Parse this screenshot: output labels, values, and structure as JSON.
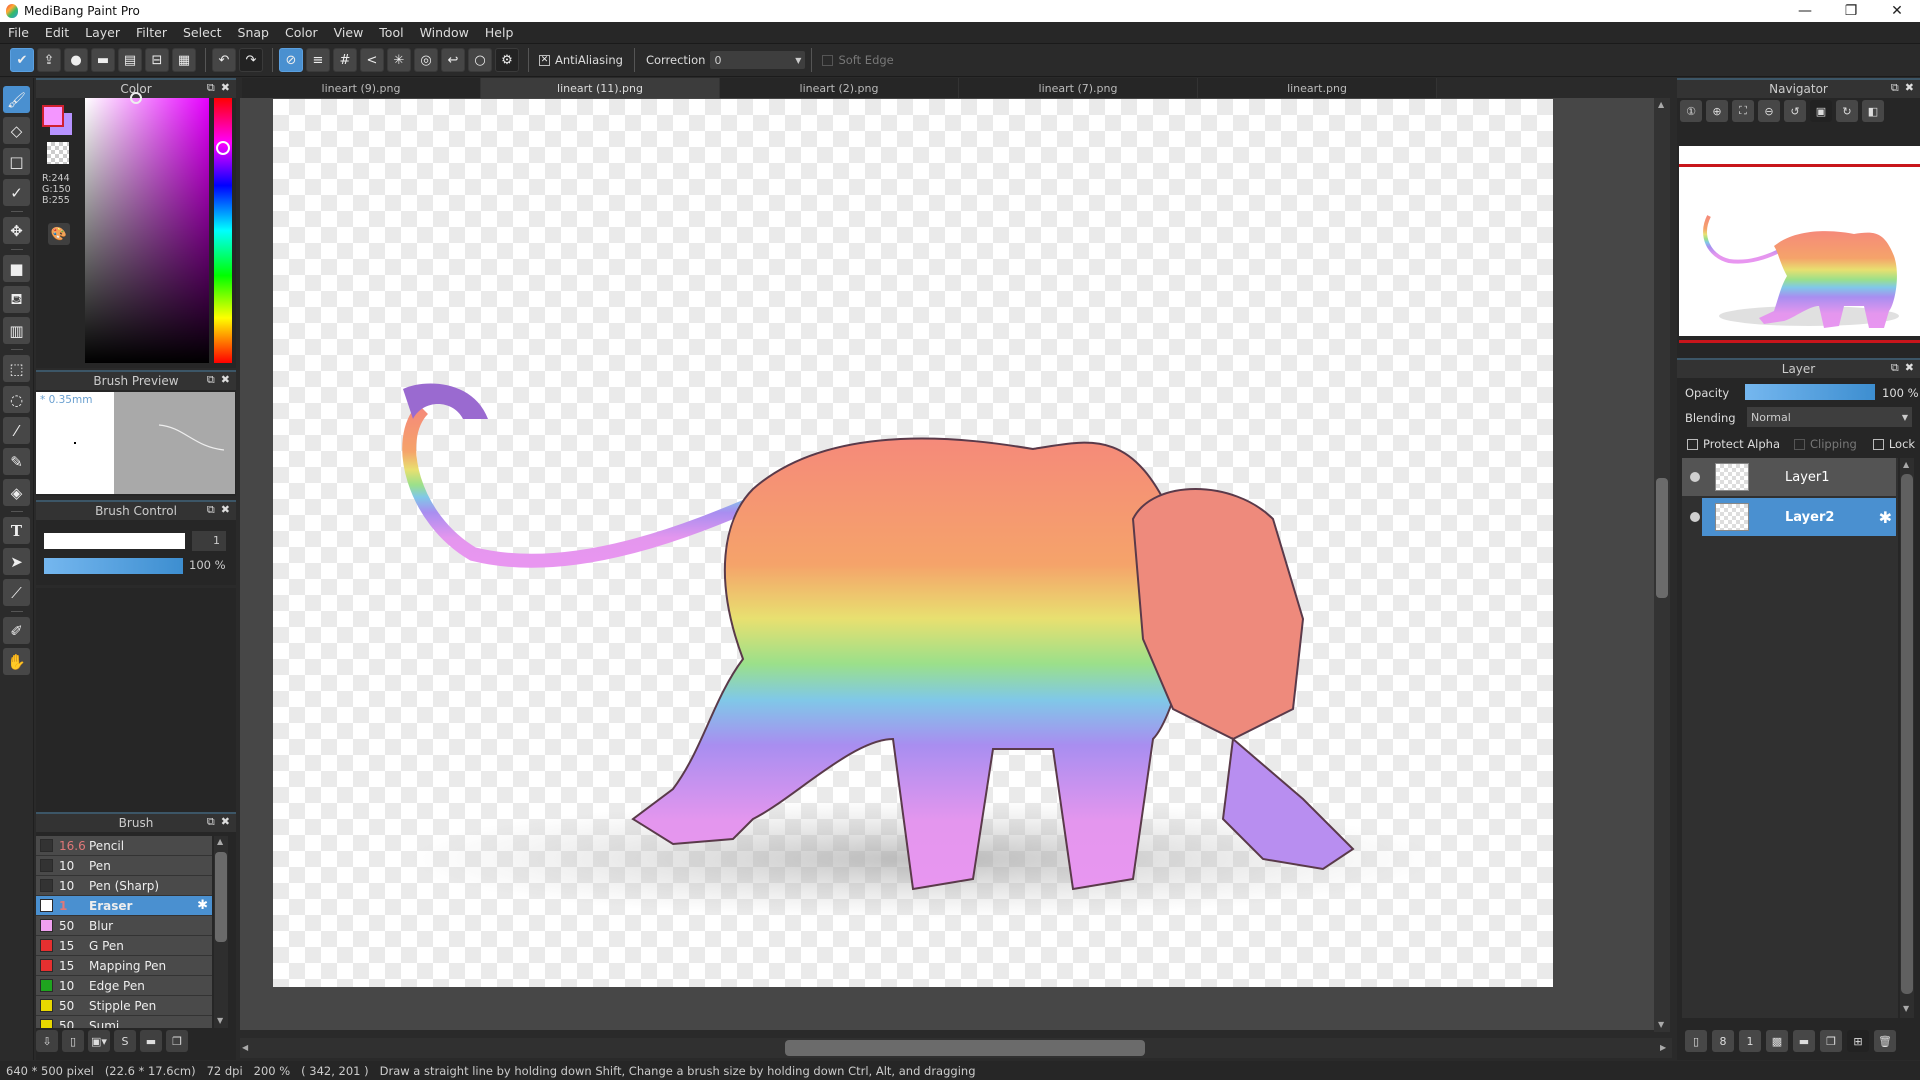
{
  "app": {
    "title": "MediBang Paint Pro",
    "window_controls": {
      "minimize": "—",
      "restore": "❐",
      "close": "✕"
    }
  },
  "menu": [
    "File",
    "Edit",
    "Layer",
    "Filter",
    "Select",
    "Snap",
    "Color",
    "View",
    "Tool",
    "Window",
    "Help"
  ],
  "toolbar": {
    "left_icons": [
      "cloud-save-icon",
      "export-icon",
      "comment-icon",
      "speech-icon",
      "document-icon",
      "schedule-icon",
      "panel-layout-icon"
    ],
    "undo_label": "↶",
    "redo_label": "↷",
    "snap_icons": [
      "snap-off-icon",
      "parallel-snap-icon",
      "grid-snap-icon",
      "perspective-snap-icon",
      "radial-snap-icon",
      "concentric-snap-icon",
      "curve-snap-icon",
      "ellipse-snap-icon",
      "snap-settings-icon"
    ],
    "antialiasing_label": "AntiAliasing",
    "antialiasing_checked": true,
    "correction_label": "Correction",
    "correction_value": "0",
    "soft_edge_label": "Soft Edge",
    "soft_edge_checked": false
  },
  "tools": [
    "brush",
    "eraser",
    "dot",
    "stroke",
    "move",
    "fill-rect",
    "bucket",
    "gradient",
    "select-rect",
    "lasso",
    "magic-wand",
    "select-pen",
    "select-eraser",
    "text",
    "operation",
    "divide",
    "eyedropper",
    "hand"
  ],
  "color_panel": {
    "title": "Color",
    "foreground": "#f496ff",
    "background": "#b793ff",
    "r": "R:244",
    "g": "G:150",
    "b": "B:255"
  },
  "brush_preview": {
    "title": "Brush Preview",
    "size": "* 0.35mm"
  },
  "brush_control": {
    "title": "Brush Control",
    "size_value": "1",
    "opacity_value": "100 %",
    "opacity_fraction": 1.0
  },
  "brush_panel": {
    "title": "Brush",
    "items": [
      {
        "size": "16.6",
        "name": "Pencil",
        "color": "#333333",
        "size_color": "#e07878"
      },
      {
        "size": "10",
        "name": "Pen",
        "color": "#333333"
      },
      {
        "size": "10",
        "name": "Pen (Sharp)",
        "color": "#333333"
      },
      {
        "size": "1",
        "name": "Eraser",
        "color": "#ffffff",
        "selected": true,
        "size_color": "#e07878"
      },
      {
        "size": "50",
        "name": "Blur",
        "color": "#f0a0f0"
      },
      {
        "size": "15",
        "name": "G Pen",
        "color": "#e53030"
      },
      {
        "size": "15",
        "name": "Mapping Pen",
        "color": "#e53030"
      },
      {
        "size": "10",
        "name": "Edge Pen",
        "color": "#1fa51f"
      },
      {
        "size": "50",
        "name": "Stipple Pen",
        "color": "#e8d800"
      },
      {
        "size": "50",
        "name": "Sumi",
        "color": "#e8d800"
      }
    ]
  },
  "tabs": [
    {
      "label": "lineart (9).png"
    },
    {
      "label": "lineart (11).png",
      "active": true
    },
    {
      "label": "lineart (2).png"
    },
    {
      "label": "lineart (7).png"
    },
    {
      "label": "lineart.png"
    }
  ],
  "navigator": {
    "title": "Navigator"
  },
  "layer_panel": {
    "title": "Layer",
    "opacity_label": "Opacity",
    "opacity_value": "100 %",
    "opacity_fraction": 1.0,
    "blending_label": "Blending",
    "blending_value": "Normal",
    "protect_alpha_label": "Protect Alpha",
    "clipping_label": "Clipping",
    "lock_label": "Lock",
    "layers": [
      {
        "name": "Layer1",
        "selected": false
      },
      {
        "name": "Layer2",
        "selected": true
      }
    ]
  },
  "status": {
    "dimensions": "640 * 500 pixel",
    "physical": "(22.6 * 17.6cm)",
    "dpi": "72 dpi",
    "zoom": "200 %",
    "cursor": "( 342, 201 )",
    "hint": "Draw a straight line by holding down Shift, Change a brush size by holding down Ctrl, Alt, and dragging"
  }
}
